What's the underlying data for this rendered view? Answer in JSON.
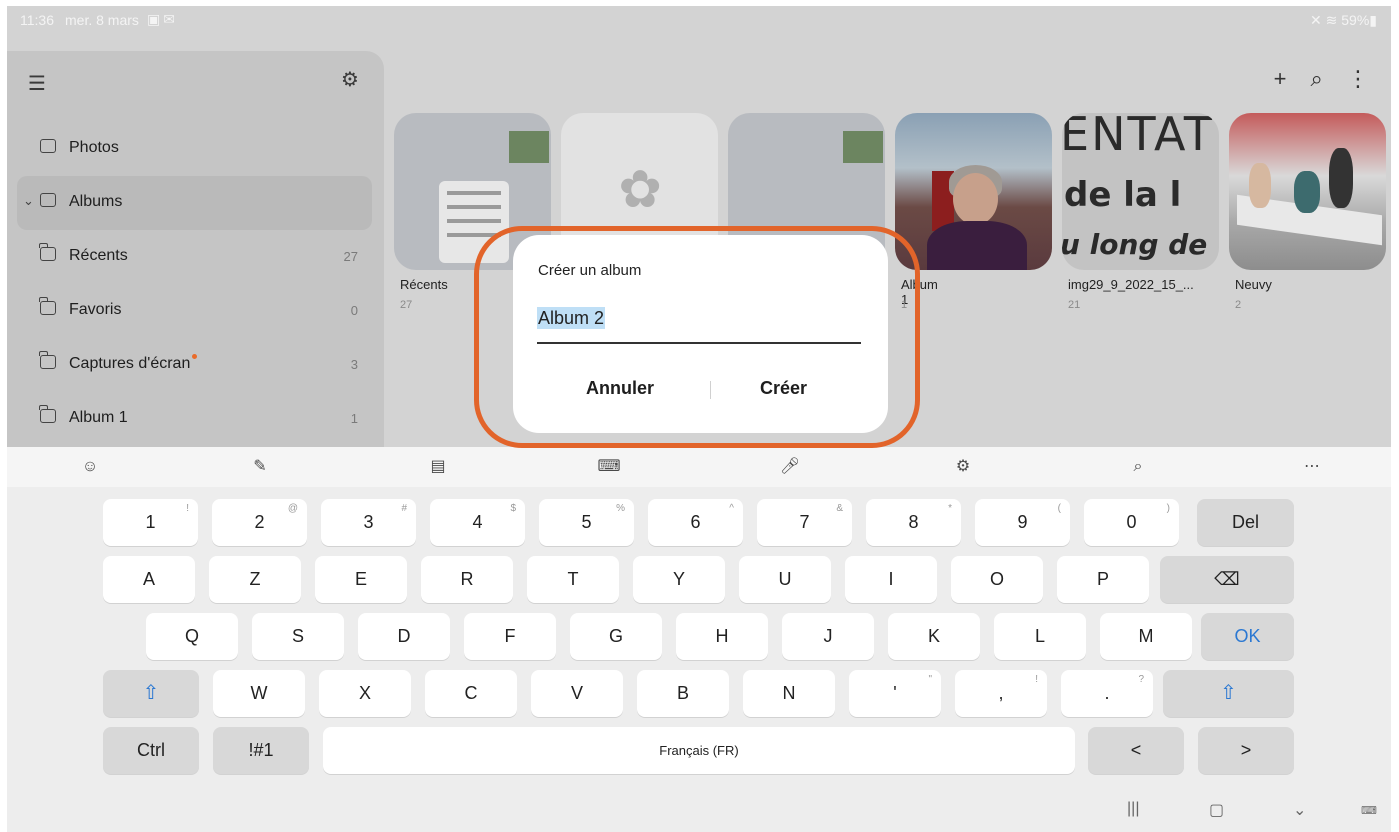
{
  "status_bar": {
    "time": "11:36",
    "date": "mer. 8 mars",
    "right": "59%"
  },
  "sidebar": {
    "items": [
      {
        "label": "Photos",
        "count": ""
      },
      {
        "label": "Albums",
        "count": ""
      },
      {
        "label": "Récents",
        "count": "27"
      },
      {
        "label": "Favoris",
        "count": "0"
      },
      {
        "label": "Captures d'écran",
        "count": "3"
      },
      {
        "label": "Album 1",
        "count": "1"
      }
    ]
  },
  "albums": [
    {
      "name": "Récents",
      "count": "27"
    },
    {
      "name": "",
      "count": ""
    },
    {
      "name": "",
      "count": ""
    },
    {
      "name": "Album 1",
      "count": "1"
    },
    {
      "name": "img29_9_2022_15_...",
      "count": "21"
    },
    {
      "name": "Neuvy",
      "count": "2"
    }
  ],
  "thumb_text": {
    "line1": "ENTAT",
    "line2": "de la l",
    "line3": "u long de"
  },
  "dialog": {
    "title": "Créer un album",
    "input_value": "Album 2",
    "cancel": "Annuler",
    "create": "Créer"
  },
  "keyboard": {
    "row1": [
      {
        "k": "1",
        "s": "!"
      },
      {
        "k": "2",
        "s": "@"
      },
      {
        "k": "3",
        "s": "#"
      },
      {
        "k": "4",
        "s": "$"
      },
      {
        "k": "5",
        "s": "%"
      },
      {
        "k": "6",
        "s": "^"
      },
      {
        "k": "7",
        "s": "&"
      },
      {
        "k": "8",
        "s": "*"
      },
      {
        "k": "9",
        "s": "("
      },
      {
        "k": "0",
        "s": ")"
      }
    ],
    "del": "Del",
    "row2": [
      "A",
      "Z",
      "E",
      "R",
      "T",
      "Y",
      "U",
      "I",
      "O",
      "P"
    ],
    "row3": [
      "Q",
      "S",
      "D",
      "F",
      "G",
      "H",
      "J",
      "K",
      "L",
      "M"
    ],
    "ok": "OK",
    "row4": [
      {
        "k": "W",
        "s": ""
      },
      {
        "k": "X",
        "s": ""
      },
      {
        "k": "C",
        "s": ""
      },
      {
        "k": "V",
        "s": ""
      },
      {
        "k": "B",
        "s": ""
      },
      {
        "k": "N",
        "s": ""
      },
      {
        "k": "'",
        "s": "\""
      },
      {
        "k": ",",
        "s": "!"
      },
      {
        "k": ".",
        "s": "?"
      }
    ],
    "ctrl": "Ctrl",
    "symbols": "!#1",
    "space": "Français (FR)",
    "left": "<",
    "right": ">"
  },
  "colors": {
    "highlight_ring": "#e2642a",
    "ok_blue": "#2b78d2"
  }
}
